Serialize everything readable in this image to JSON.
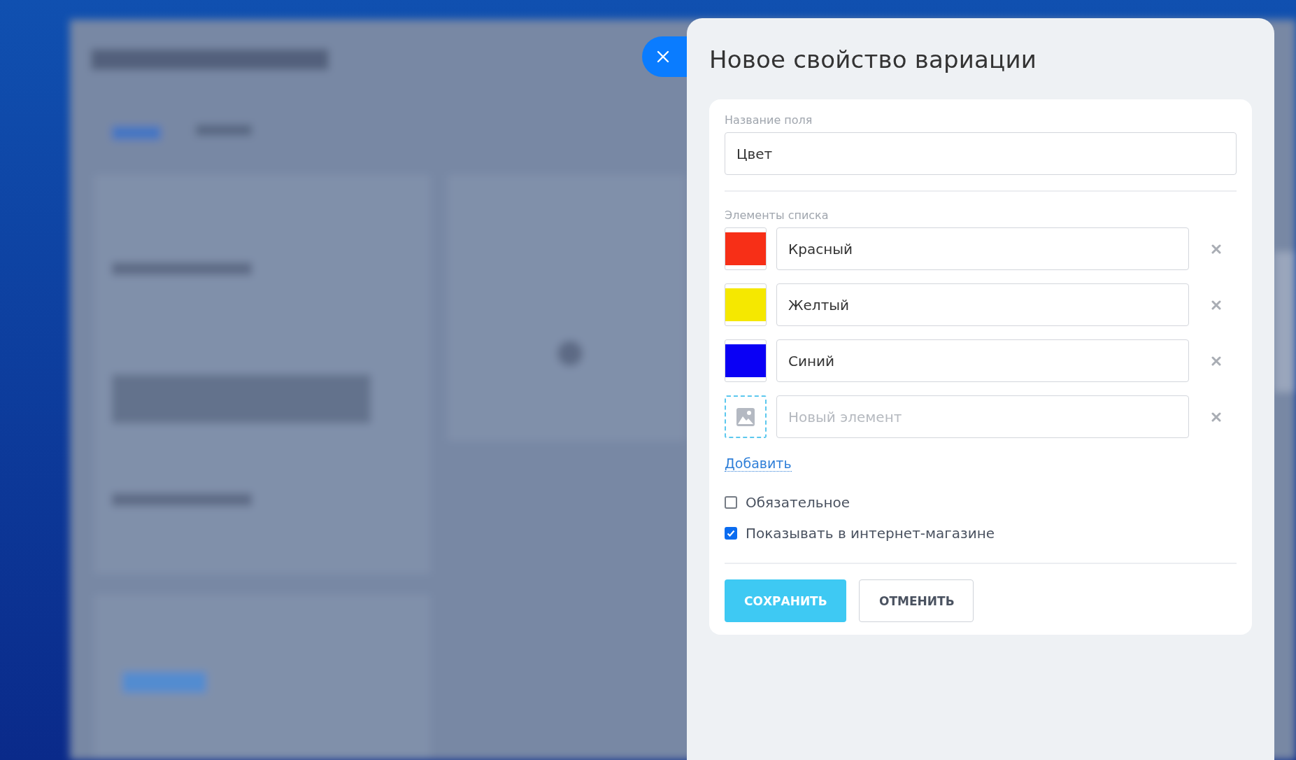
{
  "panel": {
    "title": "Новое свойство вариации"
  },
  "name_field": {
    "label": "Название поля",
    "value": "Цвет"
  },
  "list": {
    "label": "Элементы списка",
    "items": [
      {
        "kind": "color",
        "color": "#f72f17",
        "value": "Красный"
      },
      {
        "kind": "color",
        "color": "#f5e800",
        "value": "Желтый"
      },
      {
        "kind": "color",
        "color": "#0a00f5",
        "value": "Синий"
      },
      {
        "kind": "image",
        "placeholder": "Новый элемент"
      }
    ],
    "add_link": "Добавить"
  },
  "options": [
    {
      "label": "Обязательное",
      "checked": false
    },
    {
      "label": "Показывать в интернет-магазине",
      "checked": true
    }
  ],
  "buttons": [
    {
      "label": "СОХРАНИТЬ",
      "kind": "primary"
    },
    {
      "label": "ОТМЕНИТЬ",
      "kind": "secondary"
    }
  ]
}
